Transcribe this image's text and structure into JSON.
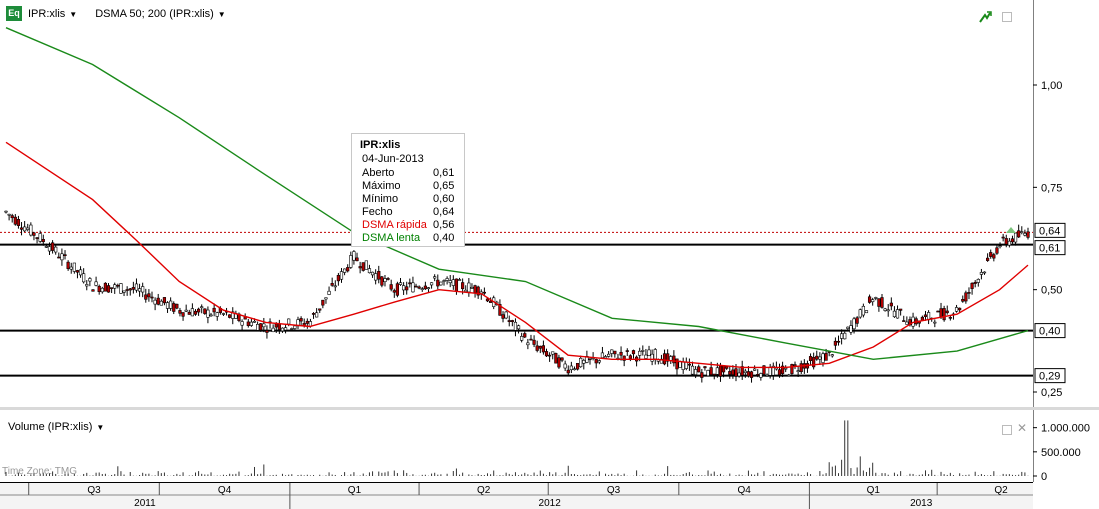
{
  "header": {
    "symbol": "IPR:xlis",
    "indicator": "DSMA 50; 200 (IPR:xlis)",
    "eq_badge": "Eq"
  },
  "tooltip": {
    "title": "IPR:xlis",
    "date": "04-Jun-2013",
    "rows": [
      {
        "label": "Aberto",
        "value": "0,61",
        "color": "#000000"
      },
      {
        "label": "Máximo",
        "value": "0,65",
        "color": "#000000"
      },
      {
        "label": "Mínimo",
        "value": "0,60",
        "color": "#000000"
      },
      {
        "label": "Fecho",
        "value": "0,64",
        "color": "#000000"
      },
      {
        "label": "DSMA rápida",
        "value": "0,56",
        "color": "#e00000"
      },
      {
        "label": "DSMA lenta",
        "value": "0,40",
        "color": "#008000"
      }
    ]
  },
  "volume_pane": {
    "label": "Volume (IPR:xlis)",
    "timezone": "Time Zone: TMG",
    "axis_labels": [
      "1.000.000",
      "500.000",
      "0"
    ]
  },
  "price_axis": {
    "tick_labels": [
      "1,00",
      "0,75",
      "0,50",
      "0,25"
    ],
    "level_labels": [
      "0,64",
      "0,61",
      "0,40",
      "0,29"
    ]
  },
  "time_axis": {
    "quarters": [
      "Q3",
      "Q4",
      "Q1",
      "Q2",
      "Q3",
      "Q4",
      "Q1",
      "Q2"
    ],
    "years": [
      "2011",
      "2012",
      "2013"
    ]
  },
  "colors": {
    "fast_ma": "#e00000",
    "slow_ma": "#1a8a1a",
    "up_candle": "#ffffff",
    "down_candle": "#b00000",
    "level_line": "#000000",
    "last_price_line": "#c00000"
  },
  "chart_data": {
    "type": "line",
    "title": "",
    "symbol": "IPR:xlis",
    "x_range": [
      "2011-06",
      "2013-06-04"
    ],
    "ylim": [
      0.25,
      1.15
    ],
    "y_ticks": [
      0.25,
      0.5,
      0.75,
      1.0
    ],
    "horizontal_levels": [
      0.61,
      0.4,
      0.29
    ],
    "last_price": 0.64,
    "grid": false,
    "series": [
      {
        "name": "DSMA rápida",
        "x": [
          "2011-06",
          "2011-08",
          "2011-09",
          "2011-10",
          "2011-11",
          "2011-12",
          "2012-01",
          "2012-02",
          "2012-03",
          "2012-04",
          "2012-05",
          "2012-06",
          "2012-07",
          "2012-08",
          "2012-09",
          "2012-10",
          "2012-11",
          "2012-12",
          "2013-01",
          "2013-02",
          "2013-03",
          "2013-04",
          "2013-05",
          "2013-06-04"
        ],
        "values": [
          0.86,
          0.72,
          0.62,
          0.52,
          0.45,
          0.42,
          0.41,
          0.44,
          0.47,
          0.5,
          0.49,
          0.42,
          0.34,
          0.33,
          0.33,
          0.32,
          0.31,
          0.31,
          0.32,
          0.36,
          0.42,
          0.44,
          0.5,
          0.56
        ]
      },
      {
        "name": "DSMA lenta",
        "x": [
          "2011-06",
          "2011-08",
          "2011-10",
          "2011-12",
          "2012-02",
          "2012-04",
          "2012-06",
          "2012-08",
          "2012-10",
          "2012-12",
          "2013-02",
          "2013-04",
          "2013-06-04"
        ],
        "values": [
          1.14,
          1.05,
          0.92,
          0.78,
          0.64,
          0.55,
          0.52,
          0.43,
          0.41,
          0.37,
          0.33,
          0.35,
          0.4
        ]
      },
      {
        "name": "IPR:xlis",
        "x": [
          "2011-06",
          "2011-07",
          "2011-08",
          "2011-09",
          "2011-10",
          "2011-11",
          "2011-12",
          "2012-01",
          "2012-02",
          "2012-03",
          "2012-04",
          "2012-05",
          "2012-06",
          "2012-07",
          "2012-08",
          "2012-09",
          "2012-10",
          "2012-11",
          "2012-12",
          "2013-01",
          "2013-02",
          "2013-03",
          "2013-04",
          "2013-05",
          "2013-06-04"
        ],
        "values": [
          0.69,
          0.61,
          0.51,
          0.5,
          0.45,
          0.44,
          0.41,
          0.42,
          0.58,
          0.5,
          0.52,
          0.5,
          0.38,
          0.31,
          0.34,
          0.34,
          0.3,
          0.3,
          0.3,
          0.34,
          0.48,
          0.42,
          0.45,
          0.61,
          0.64
        ]
      }
    ],
    "volume": {
      "ylim": [
        0,
        1200000
      ],
      "y_ticks": [
        0,
        500000,
        1000000
      ],
      "peak_value": 1150000
    }
  }
}
